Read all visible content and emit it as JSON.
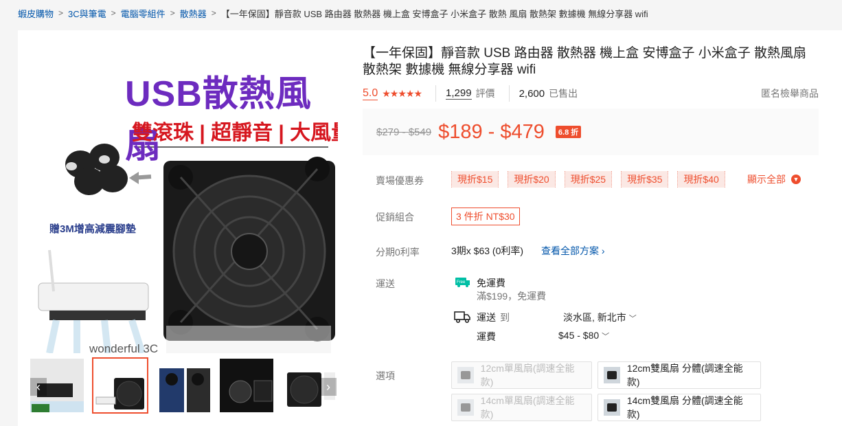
{
  "breadcrumb": {
    "items": [
      "蝦皮購物",
      "3C與筆電",
      "電腦零組件",
      "散熱器"
    ],
    "current": "【一年保固】靜音款 USB 路由器 散熱器 機上盒 安博盒子 小米盒子 散熱 風扇 散熱架 數據機 無線分享器 wifi"
  },
  "gallery": {
    "main_image": {
      "title": "USB散熱風扇",
      "subtitle": "雙滾珠 | 超靜音 | 大風量",
      "note": "贈3M增高減震腳墊",
      "brand": "wonderful 3C"
    },
    "thumbnails": [
      {
        "label": "thumb-1"
      },
      {
        "label": "thumb-2",
        "caption": "USB散熱風扇"
      },
      {
        "label": "thumb-3"
      },
      {
        "label": "thumb-4"
      },
      {
        "label": "thumb-5"
      }
    ],
    "prev_icon": "chevron-left-icon",
    "next_icon": "chevron-right-icon"
  },
  "product": {
    "title": "【一年保固】靜音款 USB 路由器 散熱器 機上盒 安博盒子 小米盒子 散熱風扇 散熱架 數據機 無線分享器 wifi",
    "rating": "5.0",
    "stars": "★★★★★",
    "review_count": "1,299",
    "review_label": "評價",
    "sold_count": "2,600",
    "sold_label": "已售出",
    "report_label": "匿名檢舉商品"
  },
  "price": {
    "original": "$279 - $549",
    "sale": "$189 - $479",
    "discount": "6.8 折"
  },
  "coupons": {
    "label": "賣場優惠券",
    "items": [
      "現折$15",
      "現折$20",
      "現折$25",
      "現折$35",
      "現折$40"
    ],
    "show_all": "顯示全部"
  },
  "combo": {
    "label": "促銷組合",
    "value": "3 件折 NT$30"
  },
  "installment": {
    "label": "分期0利率",
    "value": "3期x $63 (0利率)",
    "link": "查看全部方案 ›"
  },
  "shipping": {
    "label": "運送",
    "free_badge": "Free",
    "free_title": "免運費",
    "free_sub": "滿$199，免運費",
    "ship_to_label": "運送",
    "ship_to_word": "到",
    "location": "淡水區, 新北市",
    "fee_label": "運費",
    "fee_value": "$45 - $80"
  },
  "variations": {
    "label": "選項",
    "options": [
      {
        "text": "12cm單風扇(調速全能款)",
        "disabled": true
      },
      {
        "text": "12cm雙風扇 分體(調速全能款)",
        "disabled": false
      },
      {
        "text": "14cm單風扇(調速全能款)",
        "disabled": true
      },
      {
        "text": "14cm雙風扇 分體(調速全能款)",
        "disabled": false
      }
    ]
  },
  "colors": {
    "accent": "#ee4d2d",
    "link": "#0055aa",
    "free_green": "#00bfa5"
  }
}
